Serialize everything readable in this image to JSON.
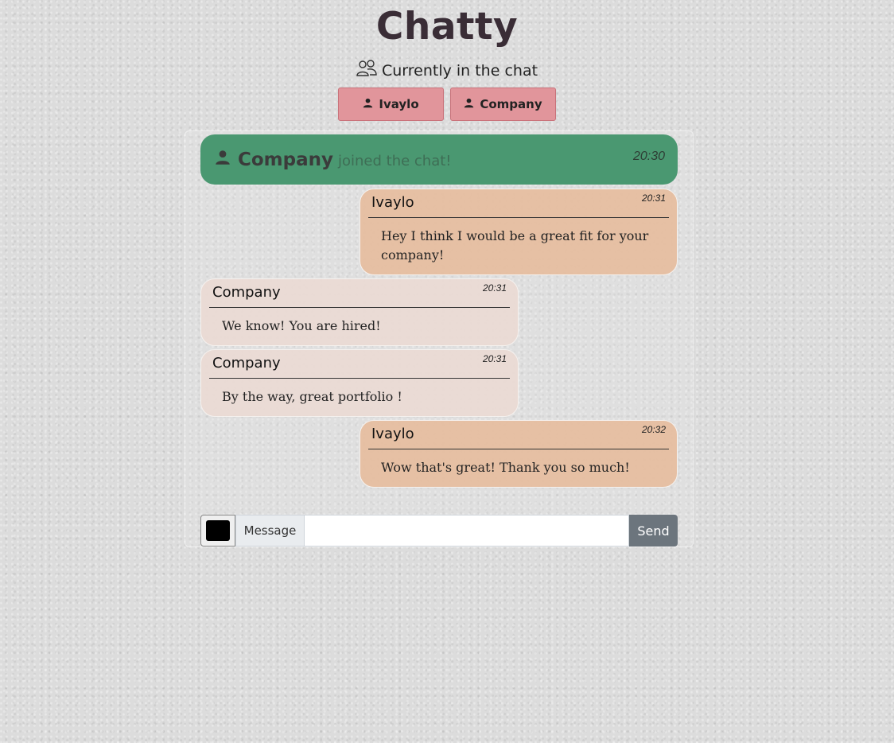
{
  "app": {
    "title": "Chatty"
  },
  "online": {
    "heading": "Currently in the chat",
    "icon": "users-icon",
    "users": [
      {
        "name": "Ivaylo",
        "icon": "person-icon"
      },
      {
        "name": "Company",
        "icon": "person-icon"
      }
    ]
  },
  "join_notice": {
    "name": "Company",
    "text": "joined the chat!",
    "time": "20:30",
    "color": "#4a9871"
  },
  "messages": [
    {
      "sender": "Ivaylo",
      "time": "20:31",
      "text": "Hey I think I would be a great fit for your company!",
      "side": "right"
    },
    {
      "sender": "Company",
      "time": "20:31",
      "text": "We know! You are hired!",
      "side": "left"
    },
    {
      "sender": "Company",
      "time": "20:31",
      "text": "By the way, great portfolio !",
      "side": "left"
    },
    {
      "sender": "Ivaylo",
      "time": "20:32",
      "text": "Wow that's great! Thank you so much!",
      "side": "right"
    }
  ],
  "composer": {
    "color_value": "#000000",
    "label": "Message",
    "input_value": "",
    "send_label": "Send"
  },
  "colors": {
    "user_button": "#e1959b",
    "own_message": "#e6bea0",
    "other_message": "#eadad4",
    "send_button": "#6c757d"
  }
}
